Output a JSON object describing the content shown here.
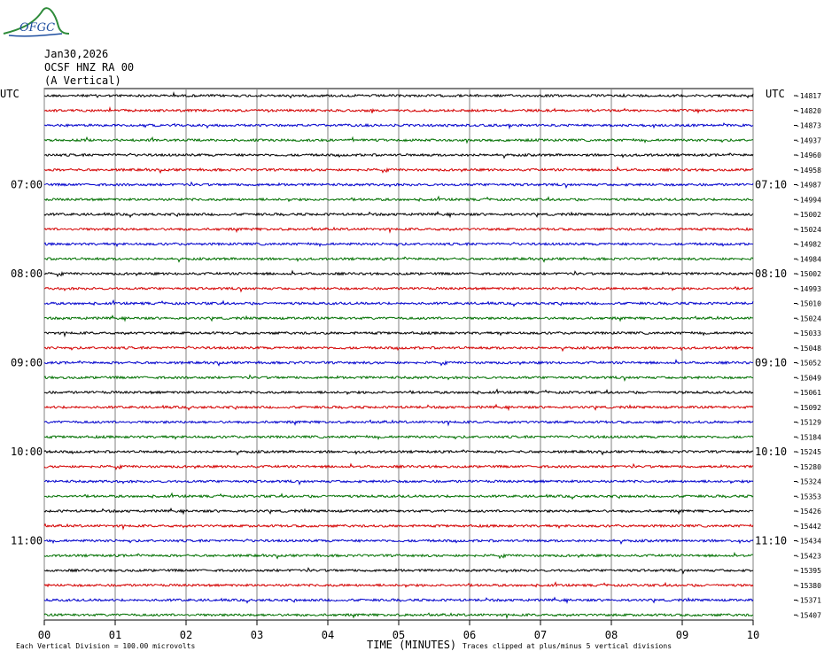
{
  "logo": {
    "text": "OFGC",
    "colors": [
      "#2e8b3a",
      "#1f4fa0"
    ]
  },
  "header": {
    "date": "Jan30,2026",
    "station": "OCSF HNZ RA 00",
    "component": "(A Vertical)"
  },
  "utc_left": "UTC",
  "utc_right": "UTC",
  "chart_data": {
    "type": "line",
    "title": "",
    "xlabel": "TIME (MINUTES)",
    "ylabel": "",
    "x_ticks": [
      "00",
      "01",
      "02",
      "03",
      "04",
      "05",
      "06",
      "07",
      "08",
      "09",
      "10"
    ],
    "xlim": [
      0,
      10
    ],
    "grid": true,
    "trace_colors": [
      "#000000",
      "#d40000",
      "#0000cc",
      "#007000"
    ],
    "left_time_labels": [
      {
        "row": 6,
        "text": "07:00"
      },
      {
        "row": 12,
        "text": "08:00"
      },
      {
        "row": 18,
        "text": "09:00"
      },
      {
        "row": 24,
        "text": "10:00"
      },
      {
        "row": 30,
        "text": "11:00"
      }
    ],
    "right_time_labels": [
      {
        "row": 6,
        "text": "07:10"
      },
      {
        "row": 12,
        "text": "08:10"
      },
      {
        "row": 18,
        "text": "09:10"
      },
      {
        "row": 24,
        "text": "10:10"
      },
      {
        "row": 30,
        "text": "11:10"
      }
    ],
    "right_values": [
      "-14817",
      "-14820",
      "-14873",
      "-14937",
      "-14960",
      "-14958",
      "-14987",
      "-14994",
      "-15002",
      "-15024",
      "-14982",
      "-14984",
      "-15002",
      "-14993",
      "-15010",
      "-15024",
      "-15033",
      "-15048",
      "-15052",
      "-15049",
      "-15061",
      "-15092",
      "-15129",
      "-15184",
      "-15245",
      "-15280",
      "-15324",
      "-15353",
      "-15426",
      "-15442",
      "-15434",
      "-15423",
      "-15395",
      "-15380",
      "-15371",
      "-15407"
    ]
  },
  "footer": {
    "scale": "Each Vertical Division =  100.00 microvolts",
    "clip_note": "Traces clipped at plus/minus 5 vertical divisions"
  }
}
